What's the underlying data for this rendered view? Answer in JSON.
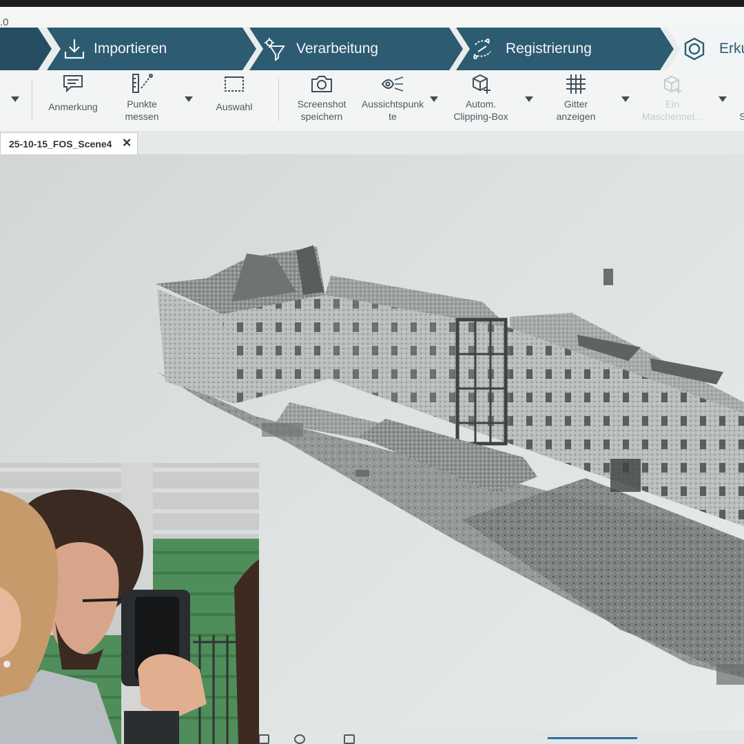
{
  "window": {
    "version_fragment": ".0"
  },
  "workflow_steps": [
    {
      "label": "",
      "icon": "",
      "selected": false
    },
    {
      "label": "Importieren",
      "icon": "import-icon",
      "selected": false
    },
    {
      "label": "Verarbeitung",
      "icon": "processing-filter-icon",
      "selected": false
    },
    {
      "label": "Registrierung",
      "icon": "registration-icon",
      "selected": false
    },
    {
      "label": "Erku",
      "icon": "explore-hexagon-icon",
      "selected": true
    }
  ],
  "toolbar": {
    "annotation": {
      "label": "Anmerkung",
      "icon": "speech-bubble-icon"
    },
    "measure": {
      "label_line1": "Punkte",
      "label_line2": "messen",
      "icon": "measure-points-icon"
    },
    "selection": {
      "label": "Auswahl",
      "icon": "selection-rectangle-icon"
    },
    "screenshot": {
      "label_line1": "Screenshot",
      "label_line2": "speichern",
      "icon": "camera-icon"
    },
    "viewpoints": {
      "label_line1": "Aussichtspunk",
      "label_line2": "te",
      "icon": "viewpoint-icon"
    },
    "clipping": {
      "label_line1": "Autom.",
      "label_line2": "Clipping-Box",
      "icon": "clipping-box-icon"
    },
    "grid": {
      "label_line1": "Gitter",
      "label_line2": "anzeigen",
      "icon": "grid-icon"
    },
    "mesh": {
      "label_line1": "Ein",
      "label_line2": "Maschennet...",
      "icon": "mesh-icon",
      "disabled": true
    },
    "partial": {
      "label": "S"
    }
  },
  "document_tab": {
    "name": "25-10-15_FOS_Scene4",
    "close": "✕"
  },
  "viewport": {
    "content": "point-cloud-building"
  },
  "colors": {
    "ribbon": "#2d5b71",
    "accent": "#2d6e9e",
    "toolbar_text": "#4a5a62"
  }
}
